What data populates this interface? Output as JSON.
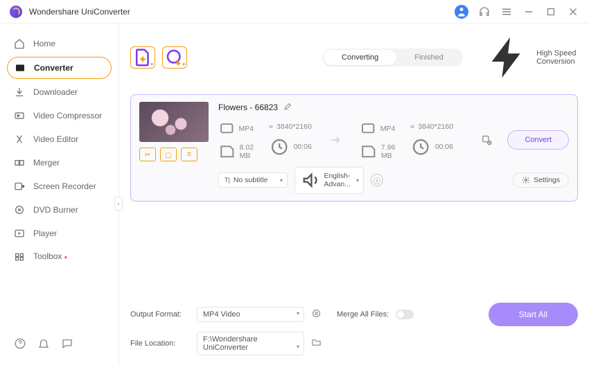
{
  "app_title": "Wondershare UniConverter",
  "sidebar": {
    "items": [
      {
        "label": "Home",
        "icon": "home-icon"
      },
      {
        "label": "Converter",
        "icon": "converter-icon"
      },
      {
        "label": "Downloader",
        "icon": "downloader-icon"
      },
      {
        "label": "Video Compressor",
        "icon": "compressor-icon"
      },
      {
        "label": "Video Editor",
        "icon": "editor-icon"
      },
      {
        "label": "Merger",
        "icon": "merger-icon"
      },
      {
        "label": "Screen Recorder",
        "icon": "recorder-icon"
      },
      {
        "label": "DVD Burner",
        "icon": "dvd-icon"
      },
      {
        "label": "Player",
        "icon": "player-icon"
      },
      {
        "label": "Toolbox",
        "icon": "toolbox-icon"
      }
    ]
  },
  "tabs": {
    "converting": "Converting",
    "finished": "Finished"
  },
  "high_speed": "High Speed Conversion",
  "file": {
    "title": "Flowers - 66823",
    "source": {
      "format": "MP4",
      "resolution": "3840*2160",
      "size": "8.02 MB",
      "duration": "00:06"
    },
    "target": {
      "format": "MP4",
      "resolution": "3840*2160",
      "size": "7.96 MB",
      "duration": "00:06"
    },
    "subtitle": "No subtitle",
    "audio": "English-Advan...",
    "settings_label": "Settings",
    "convert_label": "Convert"
  },
  "bottom": {
    "output_format_label": "Output Format:",
    "output_format_value": "MP4 Video",
    "file_location_label": "File Location:",
    "file_location_value": "F:\\Wondershare UniConverter",
    "merge_label": "Merge All Files:",
    "start_all": "Start All"
  }
}
